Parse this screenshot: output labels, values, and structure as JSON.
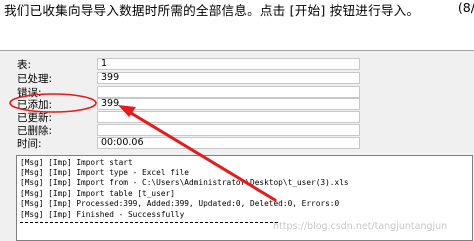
{
  "header": {
    "instruction": "我们已收集向导导入数据时所需的全部信息。点击 [开始] 按钮进行导入。",
    "page_fragment": "(8/"
  },
  "stats": [
    {
      "label": "表:",
      "value": "1"
    },
    {
      "label": "已处理:",
      "value": "399"
    },
    {
      "label": "错误:",
      "value": ""
    },
    {
      "label": "已添加:",
      "value": "399"
    },
    {
      "label": "已更新:",
      "value": ""
    },
    {
      "label": "已删除:",
      "value": ""
    },
    {
      "label": "时间:",
      "value": "00:00.06"
    }
  ],
  "log": [
    "[Msg] [Imp] Import start",
    "[Msg] [Imp] Import type - Excel file",
    "[Msg] [Imp] Import from - C:\\Users\\Administrator\\Desktop\\t_user(3).xls",
    "[Msg] [Imp] Import table [t_user]",
    "[Msg] [Imp] Processed:399, Added:399, Updated:0, Deleted:0, Errors:0",
    "[Msg] [Imp] Finished - Successfully"
  ],
  "watermark": "https://blog.csdn.net/tangjuntangjun",
  "colors": {
    "annotation": "#e8191b",
    "background": "#f0f0f0"
  },
  "annotation_icons": [
    "highlight-ellipse",
    "arrow-pointer"
  ]
}
